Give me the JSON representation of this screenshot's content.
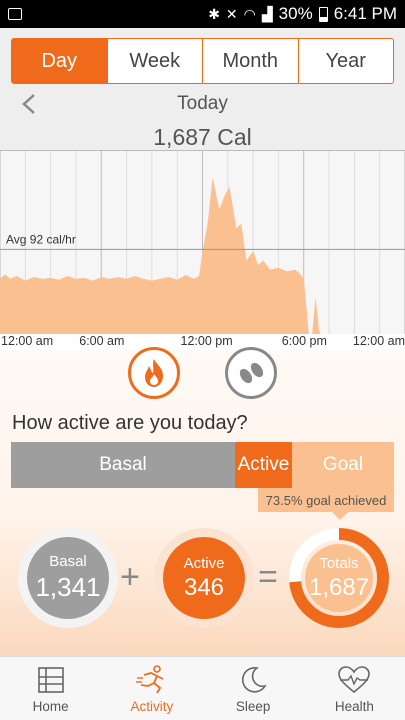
{
  "status_bar": {
    "battery": "30%",
    "time": "6:41 PM"
  },
  "tabs": [
    {
      "label": "Day",
      "active": true
    },
    {
      "label": "Week",
      "active": false
    },
    {
      "label": "Month",
      "active": false
    },
    {
      "label": "Year",
      "active": false
    }
  ],
  "header": {
    "date": "Today",
    "total_calories": "1,687 Cal"
  },
  "chart_data": {
    "type": "area",
    "title": "",
    "average_label": "Avg 92 cal/hr",
    "average_value": 92,
    "x_tick_labels": [
      "12:00 am",
      "6:00 am",
      "12:00 pm",
      "6:00 pm",
      "12:00 am"
    ],
    "x_unit": "hour",
    "x_range": [
      0,
      24
    ],
    "y_range": [
      0,
      200
    ],
    "grid": true,
    "color": "#fbc08f",
    "series": [
      {
        "x": [
          0,
          0.3,
          0.6,
          1,
          1.5,
          2,
          2.5,
          3,
          3.5,
          4,
          4.5,
          5,
          5.5,
          6,
          6.5,
          7,
          7.5,
          8,
          8.5,
          9,
          9.5,
          10,
          10.5,
          11,
          11.5,
          11.8,
          12,
          12.3,
          12.6,
          13,
          13.3,
          13.6,
          14,
          14.3,
          14.6,
          15,
          15.3,
          15.6,
          16,
          16.5,
          17,
          17.5,
          17.8,
          18,
          18.3,
          18.5,
          18.7,
          18.9,
          19,
          24
        ],
        "y": [
          60,
          65,
          60,
          63,
          58,
          62,
          60,
          61,
          59,
          63,
          60,
          61,
          58,
          62,
          60,
          62,
          60,
          63,
          60,
          58,
          60,
          62,
          59,
          64,
          60,
          63,
          90,
          120,
          170,
          135,
          150,
          160,
          115,
          120,
          80,
          90,
          75,
          80,
          70,
          72,
          68,
          70,
          65,
          60,
          0,
          0,
          40,
          5,
          0,
          0
        ]
      }
    ]
  },
  "activity": {
    "question": "How active are you today?",
    "bar_basal": "Basal",
    "bar_active": "Active",
    "bar_goal": "Goal",
    "goal_achieved": "73.5% goal achieved",
    "goal_fraction": 0.735,
    "basal_title": "Basal",
    "basal_value": "1,341",
    "active_title": "Active",
    "active_value": "346",
    "plus": "+",
    "equals": "=",
    "totals_title": "Totals",
    "totals_value": "1,687"
  },
  "nav": [
    {
      "label": "Home",
      "active": false
    },
    {
      "label": "Activity",
      "active": true
    },
    {
      "label": "Sleep",
      "active": false
    },
    {
      "label": "Health",
      "active": false
    }
  ]
}
